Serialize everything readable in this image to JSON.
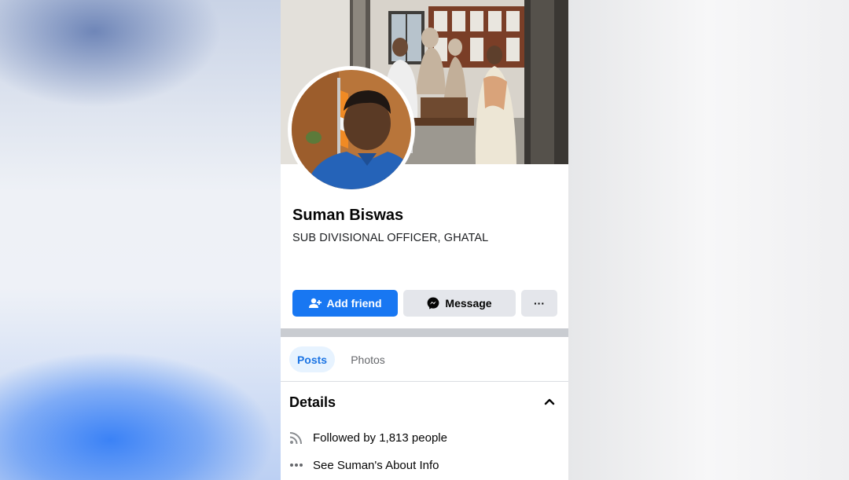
{
  "profile": {
    "name": "Suman Biswas",
    "subtitle": "SUB DIVISIONAL OFFICER, GHATAL"
  },
  "actions": {
    "add_friend_label": "Add friend",
    "message_label": "Message",
    "more_label": "···"
  },
  "tabs": [
    {
      "label": "Posts",
      "active": true
    },
    {
      "label": "Photos",
      "active": false
    }
  ],
  "details": {
    "title": "Details",
    "items": [
      {
        "icon": "rss-icon",
        "text": "Followed by 1,813 people"
      },
      {
        "icon": "more-dots-icon",
        "text": "See Suman's About Info"
      }
    ]
  },
  "colors": {
    "accent": "#1877f2",
    "tab_active_bg": "#e7f3ff",
    "button_secondary": "#e4e6eb"
  }
}
